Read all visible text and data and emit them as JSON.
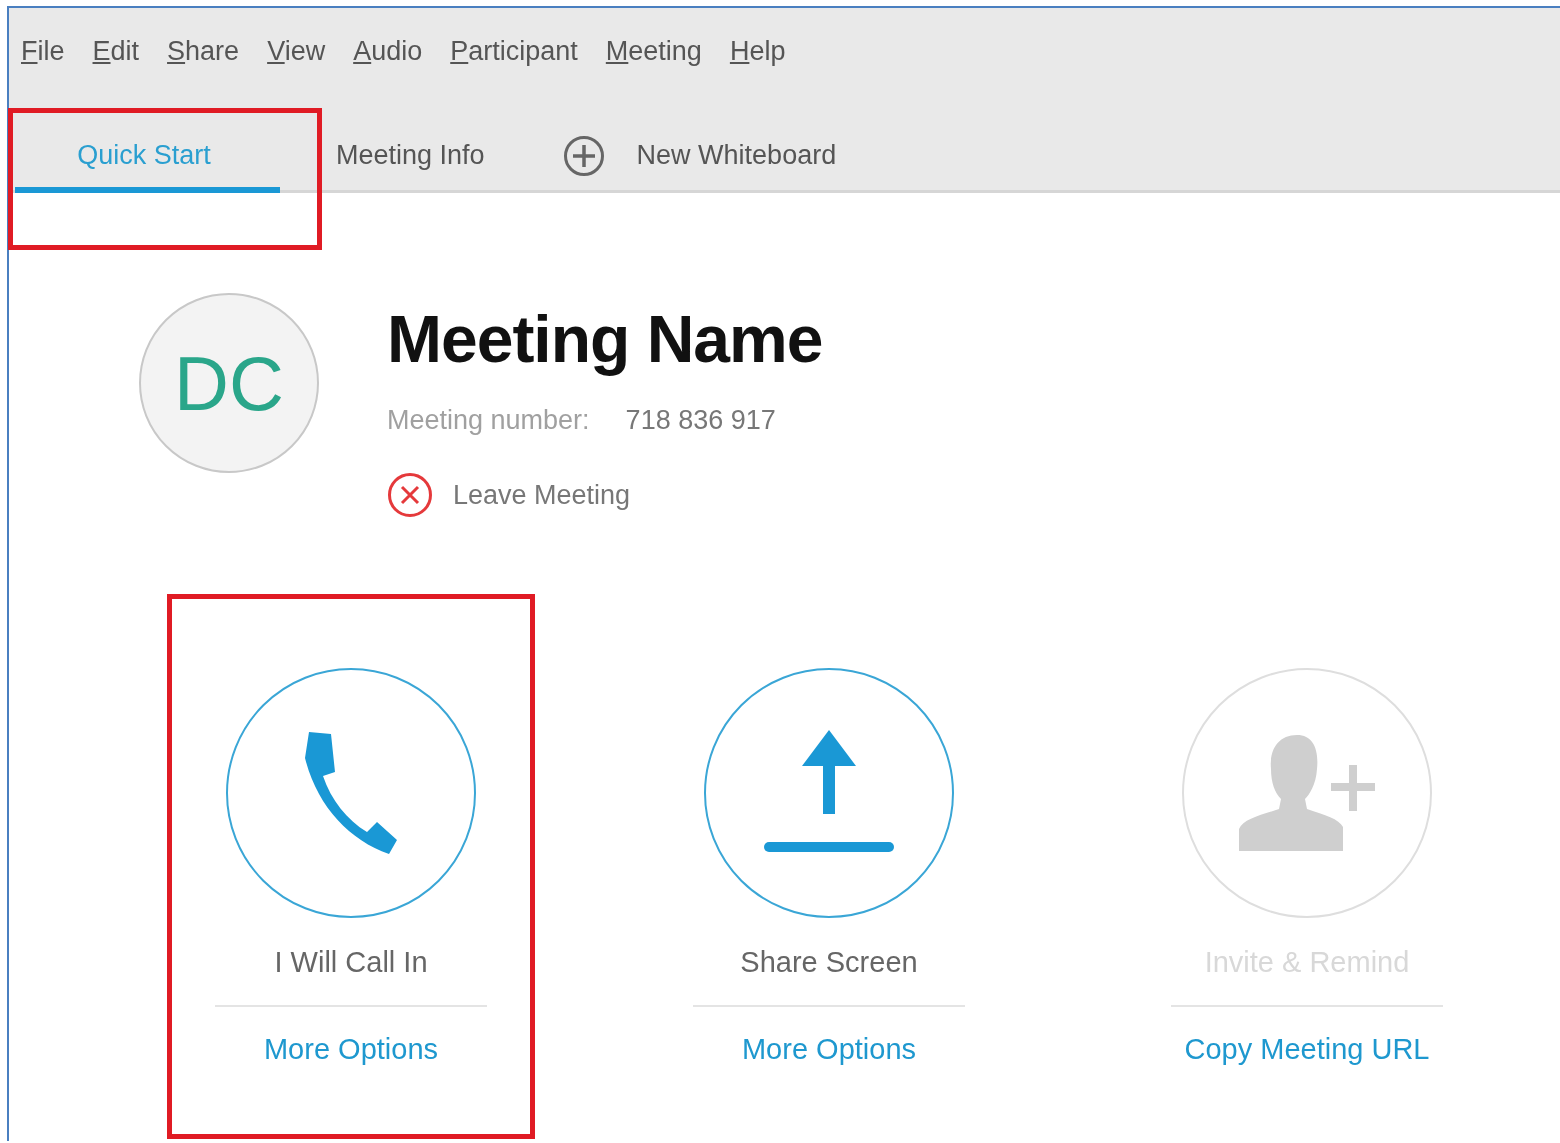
{
  "menu": [
    "File",
    "Edit",
    "Share",
    "View",
    "Audio",
    "Participant",
    "Meeting",
    "Help"
  ],
  "tabs": [
    {
      "label": "Quick Start",
      "selected": true,
      "highlighted": true,
      "kind": "tab"
    },
    {
      "label": "Meeting Info",
      "selected": false,
      "highlighted": false,
      "kind": "tab"
    },
    {
      "label": "New Whiteboard",
      "selected": false,
      "highlighted": false,
      "kind": "add"
    }
  ],
  "meeting": {
    "avatar": "DC",
    "name": "Meeting Name",
    "number_label": "Meeting number:",
    "number": "718 836 917",
    "leave": "Leave Meeting"
  },
  "actions": [
    {
      "kind": "phone",
      "label": "I Will Call In",
      "link": "More Options",
      "disabled": false,
      "highlighted": true
    },
    {
      "kind": "share",
      "label": "Share Screen",
      "link": "More Options",
      "disabled": false,
      "highlighted": false
    },
    {
      "kind": "invite",
      "label": "Invite & Remind",
      "link": "Copy Meeting URL",
      "disabled": true,
      "highlighted": false
    }
  ]
}
